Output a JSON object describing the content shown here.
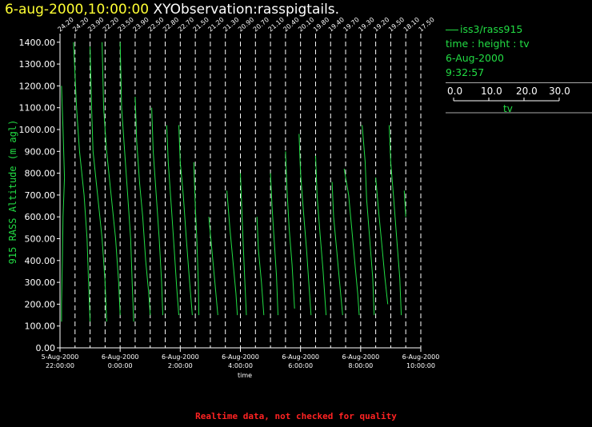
{
  "header": {
    "title_date": "6-aug-2000,10:00:00",
    "title_text": "XYObservation:rasspigtails."
  },
  "legend": {
    "series": "iss3/rass915",
    "line2": "time : height : tv",
    "line3": "6-Aug-2000",
    "line4": "9:32:57",
    "scale_ticks": [
      "0.0",
      "10.0",
      "20.0",
      "30.0"
    ],
    "scale_label": "tv"
  },
  "footer": {
    "note": "Realtime data, not checked for quality"
  },
  "colors": {
    "series": "#22dd44",
    "axis": "#ffffff",
    "grid": "#ffffff",
    "title_date": "#ffff33",
    "footer": "#ff2222",
    "ylabel": "#22dd44"
  },
  "chart_data": {
    "type": "line",
    "title": "XYObservation:rasspigtails.",
    "xlabel": "time",
    "ylabel": "915 RASS Altitude (m agl)",
    "ylim": [
      0,
      1450
    ],
    "yticks": [
      "0.00",
      "100.00",
      "200.00",
      "300.00",
      "400.00",
      "500.00",
      "600.00",
      "700.00",
      "800.00",
      "900.00",
      "1000.00",
      "1100.00",
      "1200.00",
      "1300.00",
      "1400.00"
    ],
    "xticks": [
      {
        "date": "5-Aug-2000",
        "time": "22:00:00"
      },
      {
        "date": "6-Aug-2000",
        "time": "0:00:00"
      },
      {
        "date": "6-Aug-2000",
        "time": "2:00:00"
      },
      {
        "date": "6-Aug-2000",
        "time": "4:00:00"
      },
      {
        "date": "6-Aug-2000",
        "time": "6:00:00"
      },
      {
        "date": "6-Aug-2000",
        "time": "8:00:00"
      },
      {
        "date": "6-Aug-2000",
        "time": "10:00:00"
      }
    ],
    "x_hours_range": [
      -2,
      10
    ],
    "profiles": [
      {
        "label": "24.20",
        "points": [
          [
            -1.95,
            1200
          ],
          [
            -1.9,
            1000
          ],
          [
            -1.85,
            780
          ],
          [
            -1.9,
            600
          ],
          [
            -1.92,
            400
          ],
          [
            -1.95,
            200
          ],
          [
            -1.95,
            120
          ]
        ]
      },
      {
        "label": "24.20",
        "points": [
          [
            -1.55,
            1400
          ],
          [
            -1.45,
            1100
          ],
          [
            -1.35,
            900
          ],
          [
            -1.2,
            700
          ],
          [
            -1.1,
            500
          ],
          [
            -1.05,
            300
          ],
          [
            -1.0,
            120
          ]
        ]
      },
      {
        "label": "23.90",
        "points": [
          [
            -1.0,
            1380
          ],
          [
            -0.95,
            1100
          ],
          [
            -0.9,
            900
          ],
          [
            -0.75,
            700
          ],
          [
            -0.6,
            500
          ],
          [
            -0.5,
            300
          ],
          [
            -0.45,
            120
          ]
        ]
      },
      {
        "label": "22.20",
        "points": [
          [
            -0.6,
            1400
          ],
          [
            -0.55,
            1100
          ],
          [
            -0.45,
            900
          ],
          [
            -0.3,
            700
          ],
          [
            -0.15,
            500
          ],
          [
            -0.05,
            300
          ],
          [
            0.0,
            150
          ]
        ]
      },
      {
        "label": "23.50",
        "points": [
          [
            0.0,
            1400
          ],
          [
            0.05,
            1100
          ],
          [
            0.15,
            900
          ],
          [
            0.25,
            700
          ],
          [
            0.35,
            500
          ],
          [
            0.4,
            300
          ],
          [
            0.45,
            120
          ]
        ]
      },
      {
        "label": "23.90",
        "points": [
          [
            0.5,
            1150
          ],
          [
            0.55,
            950
          ],
          [
            0.65,
            750
          ],
          [
            0.75,
            600
          ],
          [
            0.85,
            400
          ],
          [
            0.95,
            250
          ],
          [
            1.0,
            150
          ]
        ]
      },
      {
        "label": "22.50",
        "points": [
          [
            1.05,
            1100
          ],
          [
            1.1,
            900
          ],
          [
            1.2,
            700
          ],
          [
            1.3,
            500
          ],
          [
            1.38,
            300
          ],
          [
            1.42,
            150
          ]
        ]
      },
      {
        "label": "22.80",
        "points": [
          [
            1.55,
            1020
          ],
          [
            1.6,
            850
          ],
          [
            1.7,
            650
          ],
          [
            1.8,
            450
          ],
          [
            1.88,
            280
          ],
          [
            1.95,
            150
          ]
        ]
      },
      {
        "label": "22.70",
        "points": [
          [
            1.95,
            1020
          ],
          [
            2.0,
            850
          ],
          [
            2.1,
            700
          ],
          [
            2.2,
            500
          ],
          [
            2.3,
            320
          ],
          [
            2.4,
            150
          ]
        ]
      },
      {
        "label": "21.50",
        "points": [
          [
            2.45,
            850
          ],
          [
            2.5,
            650
          ],
          [
            2.55,
            500
          ],
          [
            2.6,
            300
          ],
          [
            2.62,
            150
          ]
        ]
      },
      {
        "label": "21.20",
        "points": [
          [
            2.95,
            600
          ],
          [
            3.05,
            450
          ],
          [
            3.15,
            300
          ],
          [
            3.25,
            150
          ]
        ]
      },
      {
        "label": "21.30",
        "points": [
          [
            3.55,
            720
          ],
          [
            3.65,
            550
          ],
          [
            3.75,
            400
          ],
          [
            3.85,
            250
          ],
          [
            3.9,
            150
          ]
        ]
      },
      {
        "label": "20.90",
        "points": [
          [
            4.0,
            800
          ],
          [
            4.05,
            620
          ],
          [
            4.1,
            450
          ],
          [
            4.15,
            300
          ],
          [
            4.2,
            150
          ]
        ]
      },
      {
        "label": "20.70",
        "points": [
          [
            4.55,
            600
          ],
          [
            4.6,
            450
          ],
          [
            4.7,
            300
          ],
          [
            4.78,
            150
          ]
        ]
      },
      {
        "label": "21.10",
        "points": [
          [
            5.0,
            800
          ],
          [
            5.05,
            650
          ],
          [
            5.12,
            500
          ],
          [
            5.2,
            330
          ],
          [
            5.25,
            150
          ]
        ]
      },
      {
        "label": "20.40",
        "points": [
          [
            5.5,
            900
          ],
          [
            5.55,
            720
          ],
          [
            5.62,
            550
          ],
          [
            5.72,
            380
          ],
          [
            5.8,
            180
          ]
        ]
      },
      {
        "label": "20.10",
        "points": [
          [
            5.95,
            980
          ],
          [
            6.0,
            800
          ],
          [
            6.1,
            620
          ],
          [
            6.2,
            450
          ],
          [
            6.3,
            250
          ],
          [
            6.35,
            150
          ]
        ]
      },
      {
        "label": "19.80",
        "points": [
          [
            6.5,
            880
          ],
          [
            6.55,
            700
          ],
          [
            6.65,
            520
          ],
          [
            6.75,
            350
          ],
          [
            6.85,
            150
          ]
        ]
      },
      {
        "label": "19.40",
        "points": [
          [
            7.05,
            760
          ],
          [
            7.1,
            600
          ],
          [
            7.2,
            450
          ],
          [
            7.3,
            300
          ],
          [
            7.4,
            150
          ]
        ]
      },
      {
        "label": "19.70",
        "points": [
          [
            7.45,
            820
          ],
          [
            7.6,
            700
          ],
          [
            7.7,
            550
          ],
          [
            7.8,
            400
          ],
          [
            7.9,
            250
          ],
          [
            7.95,
            150
          ]
        ]
      },
      {
        "label": "19.30",
        "points": [
          [
            8.05,
            1020
          ],
          [
            8.15,
            850
          ],
          [
            8.2,
            680
          ],
          [
            8.3,
            500
          ],
          [
            8.4,
            320
          ],
          [
            8.45,
            150
          ]
        ]
      },
      {
        "label": "19.20",
        "points": [
          [
            8.5,
            780
          ],
          [
            8.6,
            620
          ],
          [
            8.7,
            480
          ],
          [
            8.8,
            330
          ],
          [
            8.9,
            200
          ]
        ]
      },
      {
        "label": "19.50",
        "points": [
          [
            8.95,
            1020
          ],
          [
            9.0,
            850
          ],
          [
            9.1,
            680
          ],
          [
            9.2,
            500
          ],
          [
            9.3,
            320
          ],
          [
            9.35,
            150
          ]
        ]
      },
      {
        "label": "18.10",
        "points": [
          [
            9.45,
            720
          ],
          [
            9.5,
            600
          ]
        ]
      },
      {
        "label": "17.50",
        "points": []
      }
    ]
  }
}
